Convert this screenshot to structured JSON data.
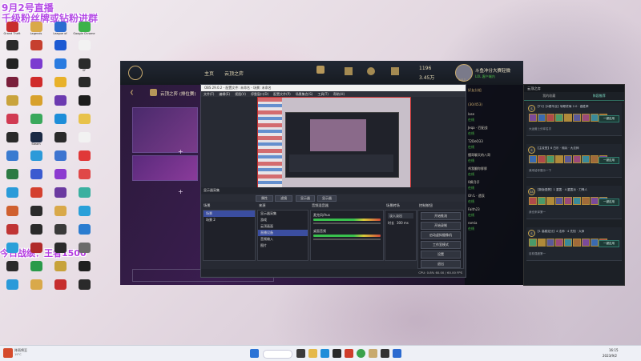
{
  "overlay": {
    "top_line1": "9月2号直播",
    "top_line2": "千级粉丝牌或钻粉进群",
    "mid_text": "今日战绩：王者1500"
  },
  "desktop_icons": [
    {
      "label": "Grand Theft",
      "color": "#c82e2e"
    },
    {
      "label": "Legends",
      "color": "#d9a94a"
    },
    {
      "label": "League of",
      "color": "#2b6cd0"
    },
    {
      "label": "Google Chrome",
      "color": "#3cb24a"
    },
    {
      "label": "",
      "color": "#2a2a2a"
    },
    {
      "label": "",
      "color": "#c63f2f"
    },
    {
      "label": "",
      "color": "#1d5ad3"
    },
    {
      "label": "",
      "color": "#f2f2f2"
    },
    {
      "label": "",
      "color": "#222"
    },
    {
      "label": "",
      "color": "#7b3bd0"
    },
    {
      "label": "",
      "color": "#2a7be0"
    },
    {
      "label": "SF",
      "color": "#2b2b2b"
    },
    {
      "label": "",
      "color": "#7a1f3b"
    },
    {
      "label": "",
      "color": "#d02b2b"
    },
    {
      "label": "",
      "color": "#e8b12a"
    },
    {
      "label": "",
      "color": "#2a2a2a"
    },
    {
      "label": "",
      "color": "#c9a33c"
    },
    {
      "label": "",
      "color": "#d8a12c"
    },
    {
      "label": "",
      "color": "#6c3ab0"
    },
    {
      "label": "",
      "color": "#1c1c1c"
    },
    {
      "label": "",
      "color": "#d13a52"
    },
    {
      "label": "",
      "color": "#3aa85c"
    },
    {
      "label": "",
      "color": "#1e8ed9"
    },
    {
      "label": "",
      "color": "#e8c24a"
    },
    {
      "label": "",
      "color": "#2a2a2a"
    },
    {
      "label": "Steam",
      "color": "#1b2a44"
    },
    {
      "label": "",
      "color": "#2a2a2a"
    },
    {
      "label": "",
      "color": "#f2f2f2"
    },
    {
      "label": "",
      "color": "#3a7bd0"
    },
    {
      "label": "",
      "color": "#2c9ad9"
    },
    {
      "label": "",
      "color": "#3d74d0"
    },
    {
      "label": "",
      "color": "#e03838"
    },
    {
      "label": "",
      "color": "#2c7a43"
    },
    {
      "label": "",
      "color": "#3b5bd0"
    },
    {
      "label": "",
      "color": "#8c3ad0"
    },
    {
      "label": "",
      "color": "#e04848"
    },
    {
      "label": "",
      "color": "#2a9bd9"
    },
    {
      "label": "",
      "color": "#d4402f"
    },
    {
      "label": "",
      "color": "#6b3aa0"
    },
    {
      "label": "",
      "color": "#3ab0a0"
    },
    {
      "label": "",
      "color": "#d0602f"
    },
    {
      "label": "",
      "color": "#2b2b2b"
    },
    {
      "label": "",
      "color": "#d9a94a"
    },
    {
      "label": "",
      "color": "#2aa0d9"
    },
    {
      "label": "",
      "color": "#c03434"
    },
    {
      "label": "",
      "color": "#2a2a2a"
    },
    {
      "label": "",
      "color": "#3a3a3a"
    },
    {
      "label": "",
      "color": "#2a7cd0"
    },
    {
      "label": "",
      "color": "#2aa0d9"
    },
    {
      "label": "",
      "color": "#b02a2a"
    },
    {
      "label": "",
      "color": "#2b2b2b"
    },
    {
      "label": "",
      "color": "#6b6b6b"
    },
    {
      "label": "",
      "color": "#2a2a2a"
    },
    {
      "label": "",
      "color": "#2a9a4a"
    },
    {
      "label": "",
      "color": "#c7a23a"
    },
    {
      "label": "",
      "color": "#1f1f1f"
    },
    {
      "label": "",
      "color": "#2a9ad9"
    },
    {
      "label": "",
      "color": "#d9a94a"
    },
    {
      "label": "",
      "color": "#c62d2d"
    },
    {
      "label": "",
      "color": "#2a2a2a"
    }
  ],
  "client": {
    "nav_home": "主页",
    "nav_tft": "云顶之弈",
    "mode_title": "云顶之弈 (排位赛)",
    "currency_be": "1196",
    "currency_rp": "3.45万",
    "username": "斗鱼冲分大赛轻微",
    "level": "5417",
    "status": "LOL 客户端内",
    "friends_header": "好友分组",
    "friends_count": "(30/453)",
    "friends": [
      "lose",
      "在线",
      "Jeqa · 匹配战",
      "在线",
      "T2DeO33",
      "在线",
      "懂哥聊天的八哥",
      "在线",
      "鸡我翻你胖胖",
      "在线",
      "0枫月仔",
      "在线",
      "Oh'L · 遗哀",
      "在线",
      "Faith23",
      "在线",
      "romia",
      "在线"
    ]
  },
  "obs": {
    "window_title": "OBS 29.0.2 - 配置文件: 未命名 - 场景: 未命名",
    "menu": [
      "文件(F)",
      "编辑(E)",
      "视图(V)",
      "停靠窗口(D)",
      "配置文件(P)",
      "场景集合(S)",
      "工具(T)",
      "帮助(H)"
    ],
    "source_label": "显示器采集",
    "tabs": [
      "属性",
      "滤镜",
      "显示器",
      "显示器"
    ],
    "scenes_title": "场景",
    "scenes": [
      "场景",
      "场景 2"
    ],
    "sources_title": "来源",
    "sources": [
      "显示器采集",
      "游戏",
      "云顶画面",
      "直播设备",
      "音频输入",
      "图片"
    ],
    "mixer_title": "音频混音器",
    "mixer_tracks": [
      "麦克风/Aux",
      "桌面音频"
    ],
    "transitions_title": "场景转场",
    "transition_value": "淡入淡出",
    "duration_label": "时长",
    "duration_value": "300 ms",
    "controls_title": "控制按钮",
    "controls": [
      "开始推流",
      "开始录制",
      "启动虚拟摄像机",
      "工作室模式",
      "设置",
      "退出"
    ],
    "status": "CPU: 0.8%  60.00 / 60.00 FPS"
  },
  "chat": {
    "title": "云顶之弈",
    "tabs": [
      "我的收藏",
      "阵容推荐"
    ],
    "cards": [
      {
        "badge": "S",
        "text": "【T1】【4费毕业】转职终局 2.0 · 高胜率",
        "button": "一键应用",
        "footer": "大运营上分拿名次"
      },
      {
        "badge": "S",
        "text": "【主攻型】6 白乐 · 佣兵 · 大法师",
        "button": "一键应用",
        "footer": "我来给你展示一下"
      },
      {
        "badge": "SS",
        "text": "【新版强势】1 重轰 · 4 重轰派 · 刀锋人",
        "button": "一键应用",
        "footer": "我也来拿第一"
      },
      {
        "badge": "S",
        "text": "【1 高稳定分】4 法师 · 4 先知 · 大师",
        "button": "一键应用",
        "footer": "目前强度第一"
      }
    ]
  },
  "taskbar": {
    "time": "16:15",
    "date": "2023/9/2",
    "weather": "阵雨将至",
    "weather_sub": "19°C"
  }
}
